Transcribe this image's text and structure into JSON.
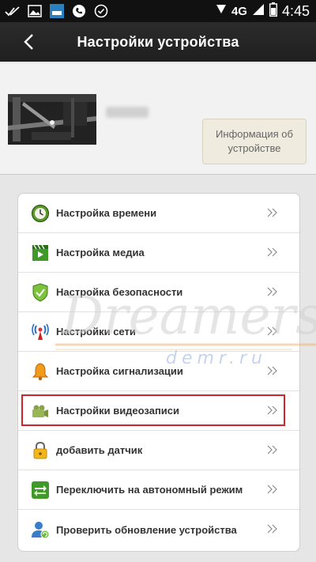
{
  "status_bar": {
    "network": "4G",
    "time": "4:45",
    "left_icons": [
      "check-marks-icon",
      "image-icon",
      "app-icon",
      "phone-icon",
      "circle-check-icon"
    ]
  },
  "header": {
    "title": "Настройки устройства"
  },
  "device": {
    "info_button": "Информация об устройстве"
  },
  "menu": {
    "items": [
      {
        "label": "Настройка времени",
        "icon": "clock-icon"
      },
      {
        "label": "Настройка медиа",
        "icon": "media-icon"
      },
      {
        "label": "Настройка безопасности",
        "icon": "shield-icon"
      },
      {
        "label": "Настройки сети",
        "icon": "antenna-icon"
      },
      {
        "label": "Настройка сигнализации",
        "icon": "bell-icon"
      },
      {
        "label": "Настройки видеозаписи",
        "icon": "video-camera-icon"
      },
      {
        "label": "добавить датчик",
        "icon": "lock-icon"
      },
      {
        "label": "Переключить на автономный режим",
        "icon": "switch-arrows-icon"
      },
      {
        "label": "Проверить обновление устройства",
        "icon": "user-update-icon"
      }
    ],
    "highlighted_index": 5
  },
  "watermark": {
    "line1": "Dreamers",
    "line2": "demr.ru"
  },
  "colors": {
    "header_bg": "#1f1f1f",
    "highlight": "#d1232a",
    "panel_bg": "#f2f2f2",
    "page_bg": "#e6e6e6"
  }
}
